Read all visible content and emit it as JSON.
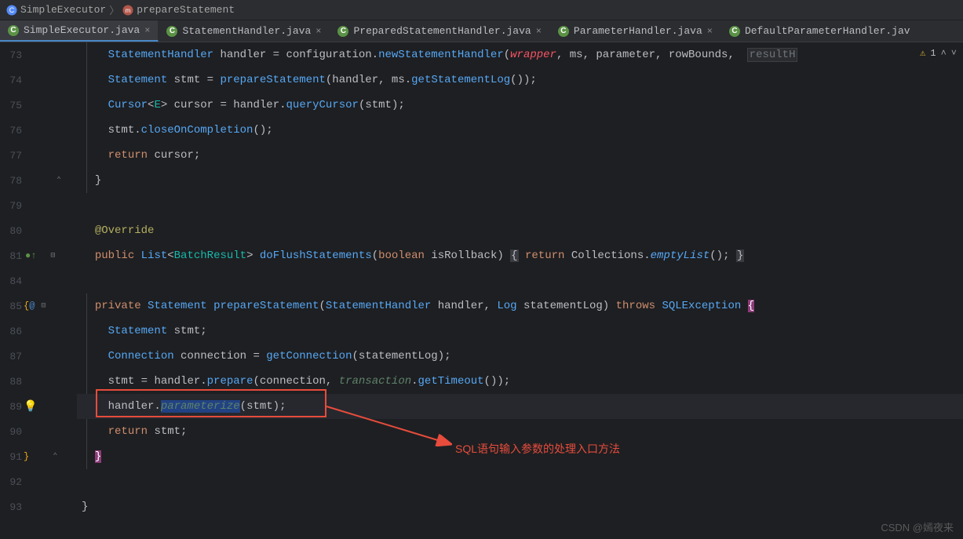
{
  "breadcrumb": {
    "class_label": "SimpleExecutor",
    "method_label": "prepareStatement"
  },
  "tabs": [
    {
      "label": "SimpleExecutor.java",
      "active": true
    },
    {
      "label": "StatementHandler.java",
      "active": false
    },
    {
      "label": "PreparedStatementHandler.java",
      "active": false
    },
    {
      "label": "ParameterHandler.java",
      "active": false
    },
    {
      "label": "DefaultParameterHandler.jav",
      "active": false
    }
  ],
  "inspection": {
    "warning_count": "1"
  },
  "code_lines": [
    {
      "n": "73",
      "html": "    <span class='tk-type'>StatementHandler</span> <span class='tk-id'>handler</span> <span class='tk-punc'>=</span> <span class='tk-id'>configuration.</span><span class='tk-fn'>newStatementHandler</span><span class='tk-punc'>(</span><span class='tk-lit'>wrapper</span><span class='tk-punc'>,</span> <span class='tk-id'>ms</span><span class='tk-punc'>,</span> <span class='tk-id'>parameter</span><span class='tk-punc'>,</span> <span class='tk-id'>rowBounds</span><span class='tk-punc'>,</span>  <span class='tk-muted hl-exec'>resultH</span>"
    },
    {
      "n": "74",
      "html": "    <span class='tk-type'>Statement</span> <span class='tk-id'>stmt</span> <span class='tk-punc'>=</span> <span class='tk-fn'>prepareStatement</span><span class='tk-punc'>(</span><span class='tk-id'>handler</span><span class='tk-punc'>,</span> <span class='tk-id'>ms.</span><span class='tk-fn'>getStatementLog</span><span class='tk-punc'>());</span>"
    },
    {
      "n": "75",
      "html": "    <span class='tk-type'>Cursor</span><span class='tk-punc'>&lt;</span><span class='tk-gen'>E</span><span class='tk-punc'>&gt;</span> <span class='tk-id'>cursor</span> <span class='tk-punc'>=</span> <span class='tk-id'>handler.</span><span class='tk-fn'>queryCursor</span><span class='tk-punc'>(</span><span class='tk-id'>stmt</span><span class='tk-punc'>);</span>"
    },
    {
      "n": "76",
      "html": "    <span class='tk-id'>stmt.</span><span class='tk-fn'>closeOnCompletion</span><span class='tk-punc'>();</span>"
    },
    {
      "n": "77",
      "html": "    <span class='tk-kw'>return</span> <span class='tk-id'>cursor</span><span class='tk-punc'>;</span>"
    },
    {
      "n": "78",
      "html": "  <span class='tk-punc'>}</span>"
    },
    {
      "n": "79",
      "html": ""
    },
    {
      "n": "80",
      "html": "  <span class='tk-ann'>@Override</span>"
    },
    {
      "n": "81",
      "html": "  <span class='tk-kw'>public</span> <span class='tk-type'>List</span><span class='tk-punc'>&lt;</span><span class='tk-teal'>BatchResult</span><span class='tk-punc'>&gt;</span> <span class='tk-fn'>doFlushStatements</span><span class='tk-punc'>(</span><span class='tk-kw'>boolean</span> <span class='tk-id'>isRollback</span><span class='tk-punc'>)</span> <span class='tk-punc hl-box'>{</span> <span class='tk-kw'>return</span> <span class='tk-id'>Collections.</span><span class='tk-fnital'>emptyList</span><span class='tk-punc'>();</span> <span class='tk-punc hl-box'>}</span>"
    },
    {
      "n": "84",
      "html": ""
    },
    {
      "n": "85",
      "html": "  <span class='tk-kw'>private</span> <span class='tk-type'>Statement</span> <span class='tk-fn'>prepareStatement</span><span class='tk-punc'>(</span><span class='tk-type'>StatementHandler</span> <span class='tk-id'>handler</span><span class='tk-punc'>,</span> <span class='tk-type'>Log</span> <span class='tk-id'>statementLog</span><span class='tk-punc'>)</span> <span class='tk-kw'>throws</span> <span class='tk-type'>SQLException</span> <span class='pink-brace'>{</span>"
    },
    {
      "n": "86",
      "html": "    <span class='tk-type'>Statement</span> <span class='tk-id'>stmt</span><span class='tk-punc'>;</span>"
    },
    {
      "n": "87",
      "html": "    <span class='tk-type'>Connection</span> <span class='tk-id'>connection</span> <span class='tk-punc'>=</span> <span class='tk-fn'>getConnection</span><span class='tk-punc'>(</span><span class='tk-id'>statementLog</span><span class='tk-punc'>);</span>"
    },
    {
      "n": "88",
      "html": "    <span class='tk-id'>stmt</span> <span class='tk-punc'>=</span> <span class='tk-id'>handler.</span><span class='tk-fn'>prepare</span><span class='tk-punc'>(</span><span class='tk-id'>connection</span><span class='tk-punc'>,</span> <span class='tk-green'>transaction</span><span class='tk-punc'>.</span><span class='tk-fn'>getTimeout</span><span class='tk-punc'>());</span>"
    },
    {
      "n": "89",
      "html": "    <span class='tk-id'>handler</span><span class='tk-punc'>.</span><span class='sel tk-greenfn'>param</span><span class='sel tk-greenfn'>eterize</span><span class='tk-punc'>(</span><span class='tk-id'>stmt</span><span class='tk-punc'>);</span>"
    },
    {
      "n": "90",
      "html": "    <span class='tk-kw'>return</span> <span class='tk-id'>stmt</span><span class='tk-punc'>;</span>"
    },
    {
      "n": "91",
      "html": "  <span class='pink-brace'>}</span>"
    },
    {
      "n": "92",
      "html": ""
    },
    {
      "n": "93",
      "html": "<span class='tk-punc'>}</span>"
    }
  ],
  "gutter_icons": {
    "78": "fold-end",
    "81": "override",
    "85": "brace-at",
    "89": "bulb",
    "91": "brace-end"
  },
  "annotation": {
    "text": "SQL语句输入参数的处理入口方法"
  },
  "watermark": "CSDN @嫣夜来"
}
